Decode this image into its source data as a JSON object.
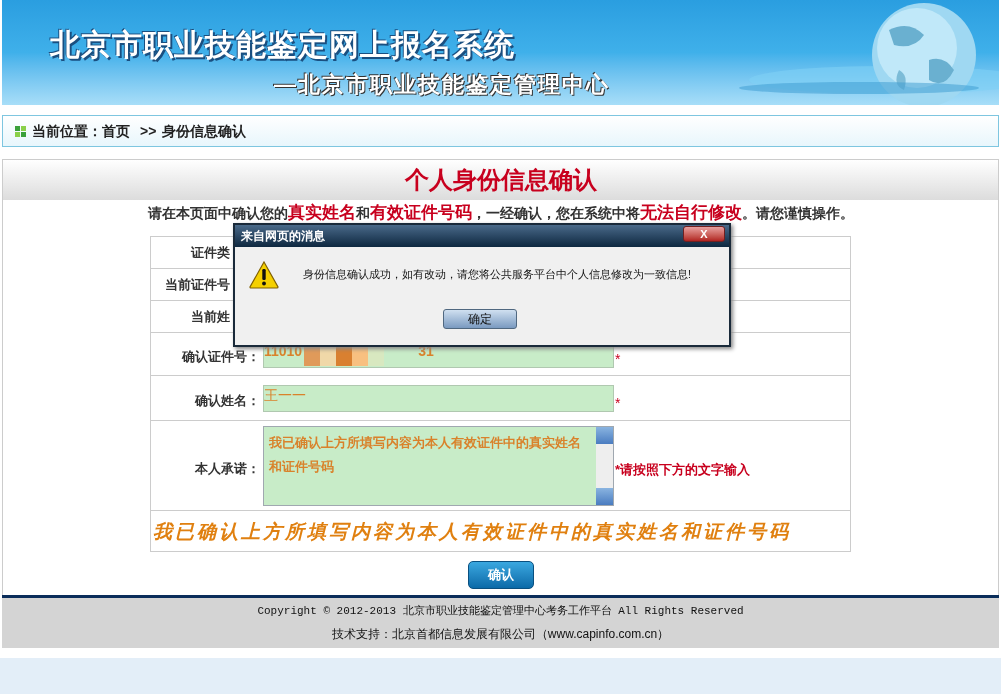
{
  "header": {
    "title": "北京市职业技能鉴定网上报名系统",
    "subtitle": "—北京市职业技能鉴定管理中心"
  },
  "breadcrumb": {
    "label": "当前位置：",
    "home": "首页",
    "separator": ">>",
    "current": "身份信息确认"
  },
  "page_title": "个人身份信息确认",
  "notice": [
    {
      "text": "请在本页面中确认您的",
      "emphasis": false
    },
    {
      "text": "真实姓名",
      "emphasis": true
    },
    {
      "text": "和",
      "emphasis": false
    },
    {
      "text": "有效证件号码",
      "emphasis": true
    },
    {
      "text": "，一经确认，您在系统中将",
      "emphasis": false
    },
    {
      "text": "无法自行修改",
      "emphasis": true
    },
    {
      "text": "。请您谨慎操作。",
      "emphasis": false
    }
  ],
  "form": {
    "rows": [
      {
        "kind": "text",
        "label": "证件类"
      },
      {
        "kind": "text",
        "label": "当前证件号"
      },
      {
        "kind": "text",
        "label": "当前姓"
      },
      {
        "kind": "masked_input",
        "label": "确认证件号：",
        "value_start": "11010",
        "value_end": "31",
        "required_mark": "*"
      },
      {
        "kind": "input",
        "label": "确认姓名：",
        "value": "王一一",
        "required_mark": "*"
      },
      {
        "kind": "textarea",
        "label": "本人承诺：",
        "value": "我已确认上方所填写内容为本人有效证件中的真实姓名和证件号码",
        "hint": "*请按照下方的文字输入"
      }
    ],
    "pledge": "我已确认上方所填写内容为本人有效证件中的真实姓名和证件号码"
  },
  "confirm_button": "确认",
  "footer": {
    "copyright": "Copyright © 2012-2013 北京市职业技能鉴定管理中心考务工作平台 All Rights Reserved",
    "support": "技术支持：北京首都信息发展有限公司（www.capinfo.com.cn）"
  },
  "dialog": {
    "title": "来自网页的消息",
    "close": "X",
    "message": "身份信息确认成功，如有改动，请您将公共服务平台中个人信息修改为一致信息!",
    "button": "确定"
  }
}
